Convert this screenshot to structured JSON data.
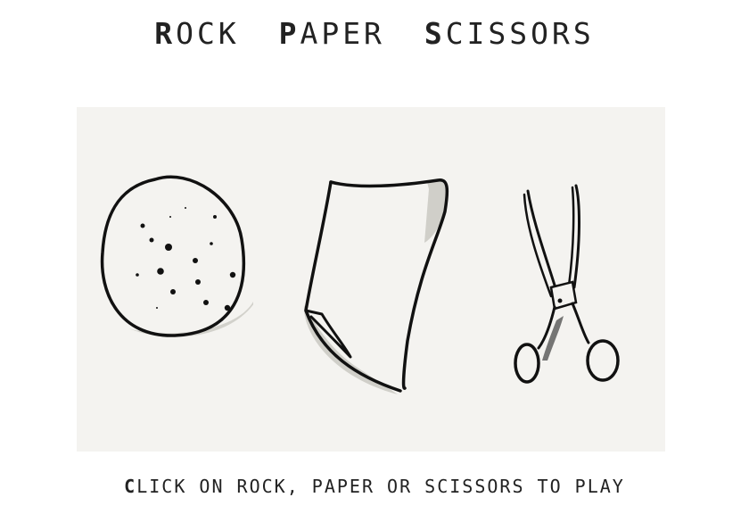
{
  "header": {
    "words": [
      {
        "initial": "R",
        "rest": "OCK"
      },
      {
        "initial": "P",
        "rest": "APER"
      },
      {
        "initial": "S",
        "rest": "CISSORS"
      }
    ]
  },
  "choices": [
    {
      "label": "rock",
      "icon": "rock-icon"
    },
    {
      "label": "paper",
      "icon": "paper-icon"
    },
    {
      "label": "scissors",
      "icon": "scissors-icon"
    }
  ],
  "footer": {
    "initial": "C",
    "rest": "LICK ON ROCK, PAPER OR SCISSORS TO PLAY"
  },
  "colors": {
    "board": "#f4f3f0",
    "ink": "#111111",
    "shadow": "#c9c8c2"
  }
}
